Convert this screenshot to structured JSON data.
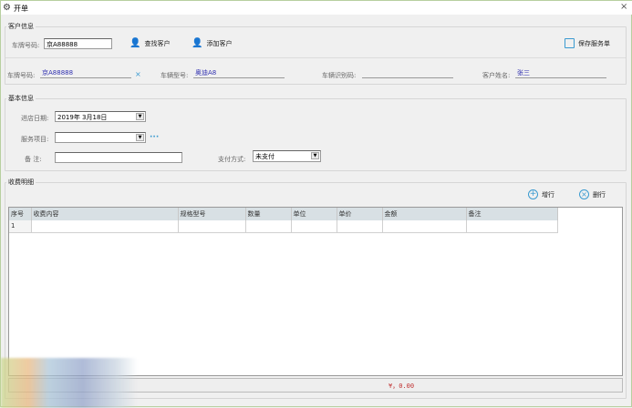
{
  "window": {
    "title": "开单",
    "close": "×"
  },
  "customer": {
    "group_label": "客户信息",
    "plate_label": "车牌号码:",
    "plate_value": "京A88888",
    "find_label": "查找客户",
    "add_label": "添加客户",
    "save_label": "保存服务单",
    "info_plate_label": "车牌号码:",
    "info_plate_value": "京A88888",
    "clear": "×",
    "model_label": "车辆型号:",
    "model_value": "奥迪A8",
    "vin_label": "车辆识别码:",
    "vin_value": "",
    "name_label": "客户姓名:",
    "name_value": "张三"
  },
  "basic": {
    "group_label": "基本信息",
    "date_label": "进店日期:",
    "date_value": "2019年  3月18日",
    "service_label": "服务项目:",
    "service_value": "",
    "more": "···",
    "note_label": "备   注:",
    "note_value": "",
    "pay_label": "支付方式:",
    "pay_value": "未支付"
  },
  "charges": {
    "group_label": "收费明细",
    "add_row": "增行",
    "del_row": "删行",
    "columns": [
      "序号",
      "收费内容",
      "规格型号",
      "数量",
      "单位",
      "单价",
      "金额",
      "备注"
    ],
    "rows": [
      [
        "1",
        "",
        "",
        "",
        "",
        "",
        "",
        ""
      ]
    ],
    "total": "¥，0.00"
  },
  "colors": {
    "accent": "#3a9ad0",
    "link": "#3030b0",
    "total": "#c03030"
  }
}
